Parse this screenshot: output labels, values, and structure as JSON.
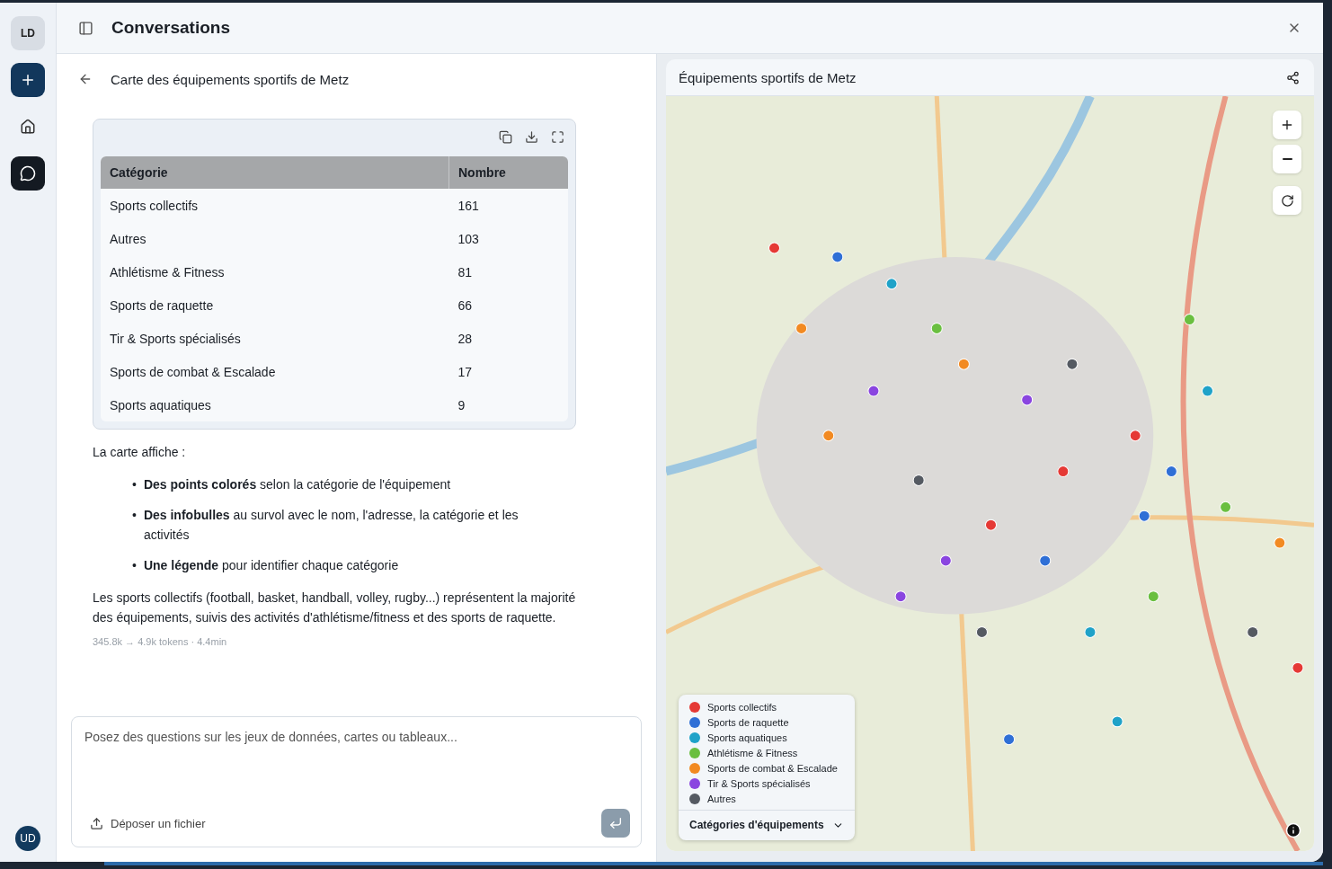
{
  "rail": {
    "user_initials": "LD",
    "account_initials": "UD",
    "items": [
      {
        "kind": "new"
      },
      {
        "kind": "home",
        "selected": false
      },
      {
        "kind": "chat",
        "selected": true
      }
    ]
  },
  "header": {
    "title": "Conversations"
  },
  "conversation": {
    "title": "Carte des équipements sportifs de Metz",
    "table": {
      "columns": [
        "Catégorie",
        "Nombre"
      ],
      "rows": [
        [
          "Sports collectifs",
          "161"
        ],
        [
          "Autres",
          "103"
        ],
        [
          "Athlétisme & Fitness",
          "81"
        ],
        [
          "Sports de raquette",
          "66"
        ],
        [
          "Tir & Sports spécialisés",
          "28"
        ],
        [
          "Sports de combat & Escalade",
          "17"
        ],
        [
          "Sports aquatiques",
          "9"
        ]
      ]
    },
    "intro": "La carte affiche :",
    "bullets": [
      {
        "marker": "•",
        "text": "**Des points colorés** selon la catégorie de l'équipement"
      },
      {
        "marker": "•",
        "text": "**Des infobulles** au survol avec le nom, l'adresse, la catégorie et les activités"
      },
      {
        "marker": "•",
        "text": "**Une légende** pour identifier chaque catégorie"
      }
    ],
    "summary": "Les sports collectifs (football, basket, handball, volley, rugby...) représentent la majorité des équipements, suivis des activités d'athlétisme/fitness et des sports de raquette.",
    "meta": "345.8k → 4.9k tokens · 4.4min"
  },
  "composer": {
    "placeholder": "Posez des questions sur les jeux de données, cartes ou tableaux...",
    "upload_label": "Déposer un fichier"
  },
  "map_panel": {
    "title": "Équipements sportifs de Metz",
    "legend_title": "Catégories d'équipements",
    "legend": [
      {
        "label": "Sports collectifs",
        "color": "#e53935"
      },
      {
        "label": "Sports de raquette",
        "color": "#2f6fd6"
      },
      {
        "label": "Sports aquatiques",
        "color": "#1fa2c8"
      },
      {
        "label": "Athlétisme & Fitness",
        "color": "#6abf40"
      },
      {
        "label": "Sports de combat & Escalade",
        "color": "#f28a22"
      },
      {
        "label": "Tir & Sports spécialisés",
        "color": "#8a45e0"
      },
      {
        "label": "Autres",
        "color": "#555a62"
      }
    ]
  }
}
